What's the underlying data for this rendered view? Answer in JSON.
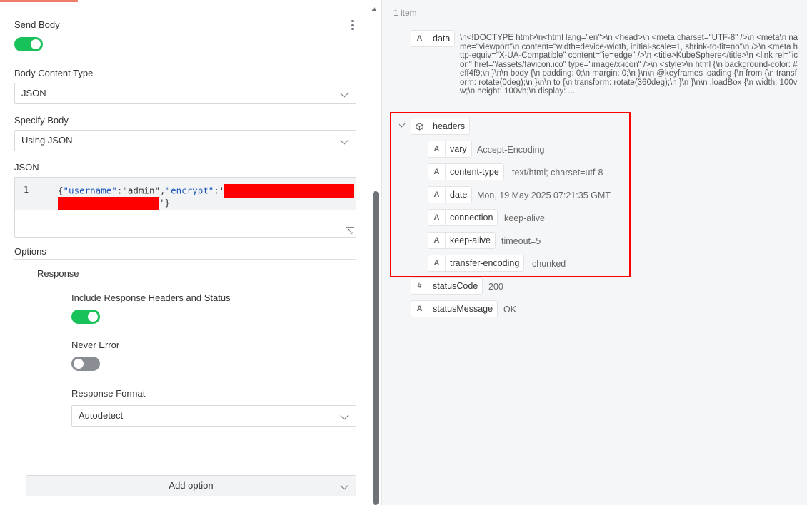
{
  "left_panel": {
    "send_body_label": "Send Body",
    "send_body_on": true,
    "body_content_type": {
      "label": "Body Content Type",
      "value": "JSON"
    },
    "specify_body": {
      "label": "Specify Body",
      "value": "Using JSON"
    },
    "json": {
      "label": "JSON",
      "line_number": "1",
      "line1_open": "{",
      "line1_key1": "\"username\"",
      "line1_colon1": ":",
      "line1_val1": "\"admin\"",
      "line1_comma": ",",
      "line1_key2": "\"encrypt\"",
      "line1_colon2": ":'",
      "line2_close": "'}"
    },
    "options_label": "Options",
    "response": {
      "label": "Response",
      "include_headers_label": "Include Response Headers and Status",
      "include_headers_on": true,
      "never_error_label": "Never Error",
      "never_error_on": false,
      "response_format": {
        "label": "Response Format",
        "value": "Autodetect"
      }
    },
    "add_option_label": "Add option"
  },
  "right_panel": {
    "count": "1 item",
    "data_field": {
      "icon": "A",
      "name": "data",
      "value": "\\n<!DOCTYPE html>\\n<html lang=\"en\">\\n <head>\\n <meta charset=\"UTF-8\" />\\n <meta\\n name=\"viewport\"\\n content=\"width=device-width, initial-scale=1, shrink-to-fit=no\"\\n />\\n <meta http-equiv=\"X-UA-Compatible\" content=\"ie=edge\" />\\n <title>KubeSphere</title>\\n <link rel=\"icon\" href=\"/assets/favicon.ico\" type=\"image/x-icon\" />\\n <style>\\n html {\\n background-color: #eff4f9;\\n }\\n\\n body {\\n padding: 0;\\n margin: 0;\\n }\\n\\n @keyframes loading {\\n from {\\n transform: rotate(0deg);\\n }\\n\\n to {\\n transform: rotate(360deg);\\n }\\n }\\n\\n .loadBox {\\n width: 100vw;\\n height: 100vh;\\n display: ..."
    },
    "headers": {
      "name": "headers",
      "items": [
        {
          "icon": "A",
          "key": "vary",
          "value": "Accept-Encoding"
        },
        {
          "icon": "A",
          "key": "content-type",
          "value": "text/html; charset=utf-8"
        },
        {
          "icon": "A",
          "key": "date",
          "value": "Mon, 19 May 2025 07:21:35 GMT"
        },
        {
          "icon": "A",
          "key": "connection",
          "value": "keep-alive"
        },
        {
          "icon": "A",
          "key": "keep-alive",
          "value": "timeout=5"
        },
        {
          "icon": "A",
          "key": "transfer-encoding",
          "value": "chunked"
        }
      ]
    },
    "status_code": {
      "icon": "#",
      "name": "statusCode",
      "value": "200"
    },
    "status_message": {
      "icon": "A",
      "name": "statusMessage",
      "value": "OK"
    }
  },
  "colors": {
    "toggle_on": "#18c25a",
    "toggle_off": "#8a8d94",
    "redaction": "#ff0000",
    "highlight_border": "#ff0000",
    "json_key": "#1a55b8"
  }
}
